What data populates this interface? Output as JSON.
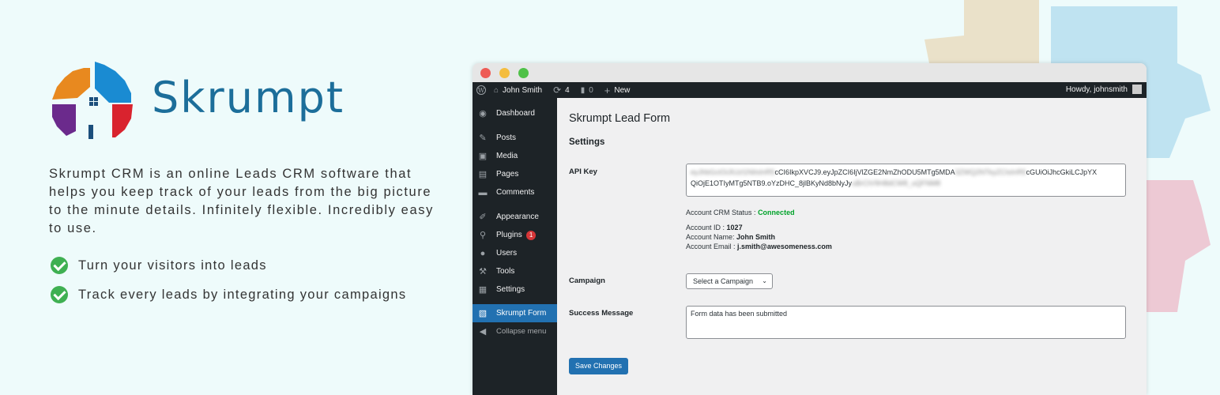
{
  "brand": {
    "name": "Skrumpt",
    "description": "Skrumpt CRM is an online Leads CRM software that helps you keep track of your leads from the big picture to the minute details. Infinitely flexible. Incredibly easy to use.",
    "features": [
      "Turn your visitors into leads",
      "Track every leads by integrating your campaigns"
    ]
  },
  "admin_bar": {
    "site_name": "John Smith",
    "updates_count": "4",
    "comments_count": "0",
    "new_label": "New",
    "howdy": "Howdy, johnsmith"
  },
  "sidebar": {
    "items": [
      {
        "label": "Dashboard",
        "icon": "dashboard-icon"
      },
      {
        "label": "Posts",
        "icon": "pin-icon"
      },
      {
        "label": "Media",
        "icon": "media-icon"
      },
      {
        "label": "Pages",
        "icon": "pages-icon"
      },
      {
        "label": "Comments",
        "icon": "comment-icon"
      },
      {
        "label": "Appearance",
        "icon": "brush-icon"
      },
      {
        "label": "Plugins",
        "icon": "plugin-icon",
        "badge": "1"
      },
      {
        "label": "Users",
        "icon": "user-icon"
      },
      {
        "label": "Tools",
        "icon": "wrench-icon"
      },
      {
        "label": "Settings",
        "icon": "settings-icon"
      },
      {
        "label": "Skrumpt Form",
        "icon": "form-icon"
      },
      {
        "label": "Collapse menu",
        "icon": "collapse-icon"
      }
    ]
  },
  "form": {
    "title": "Skrumpt Lead Form",
    "section": "Settings",
    "api_key_label": "API Key",
    "api_key_line1_blur_a": "eyJhbGciOiJIUzI1NiIsInR5",
    "api_key_line1_clear_a": "cCI6IkpXVCJ9.eyJpZCI6IjVlZGE2NmZhODU5MTg5MDA",
    "api_key_line1_blur_b": "3ZWQ2NTkyZCIsInR5",
    "api_key_line1_clear_b": "cGUiOiJhcGkiLCJpYX",
    "api_key_line2_clear": "QiOjE1OTIyMTg5NTB9.oYzDHC_8jlBKyNd8bNyJy",
    "api_key_line2_blur": "uBrCtV9H8dCW8_uQFNM8",
    "status_label": "Account CRM Status :",
    "status_value": "Connected",
    "account_id_label": "Account ID :",
    "account_id": "1027",
    "account_name_label": "Account Name:",
    "account_name": "John Smith",
    "account_email_label": "Account Email :",
    "account_email": "j.smith@awesomeness.com",
    "campaign_label": "Campaign",
    "campaign_selected": "Select a Campaign",
    "success_label": "Success Message",
    "success_value": "Form data has been submitted",
    "save_label": "Save Changes"
  },
  "colors": {
    "accent": "#2271b1",
    "connected": "#00a32a",
    "brand": "#1c6e9a",
    "check": "#3fb052"
  }
}
